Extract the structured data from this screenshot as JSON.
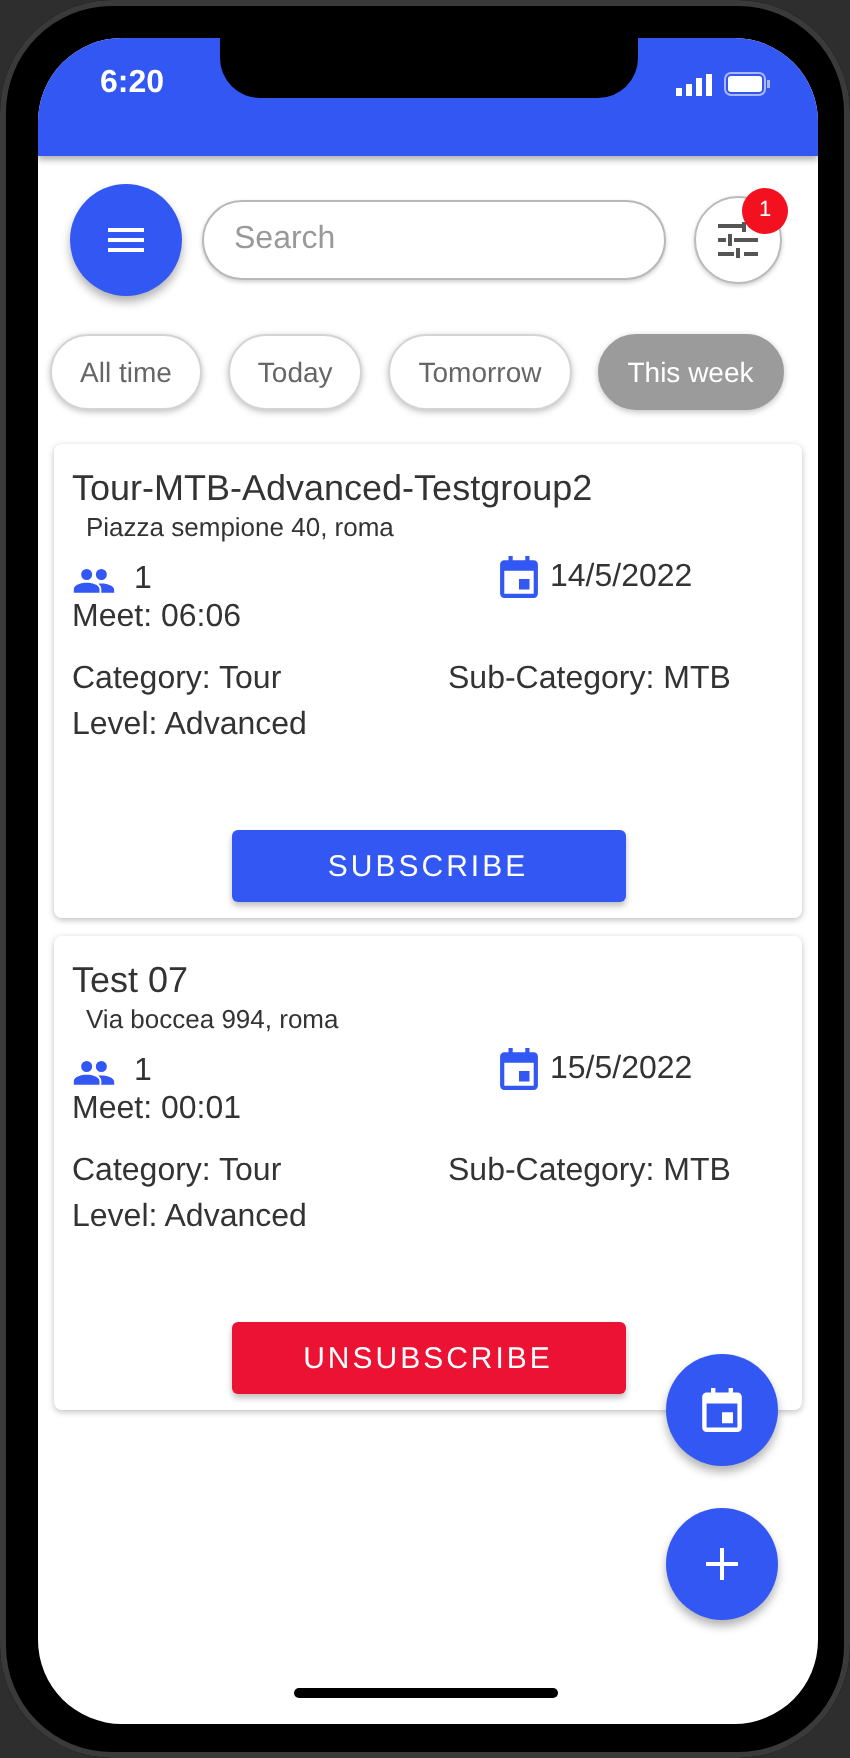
{
  "status_bar": {
    "time": "6:20"
  },
  "search": {
    "placeholder": "Search"
  },
  "filter": {
    "badge": "1"
  },
  "chips": [
    {
      "label": "All time",
      "selected": false
    },
    {
      "label": "Today",
      "selected": false
    },
    {
      "label": "Tomorrow",
      "selected": false
    },
    {
      "label": "This week",
      "selected": true
    }
  ],
  "events": [
    {
      "title": "Tour-MTB-Advanced-Testgroup2",
      "address": "Piazza sempione 40, roma",
      "participants": "1",
      "date": "14/5/2022",
      "meet": "Meet: 06:06",
      "category": "Category: Tour",
      "sub_category": "Sub-Category: MTB",
      "level": "Level: Advanced",
      "action": {
        "label": "SUBSCRIBE",
        "kind": "subscribe"
      }
    },
    {
      "title": "Test 07",
      "address": "Via boccea 994, roma",
      "participants": "1",
      "date": "15/5/2022",
      "meet": "Meet: 00:01",
      "category": "Category: Tour",
      "sub_category": "Sub-Category: MTB",
      "level": "Level: Advanced",
      "action": {
        "label": "UNSUBSCRIBE",
        "kind": "unsubscribe"
      }
    }
  ]
}
